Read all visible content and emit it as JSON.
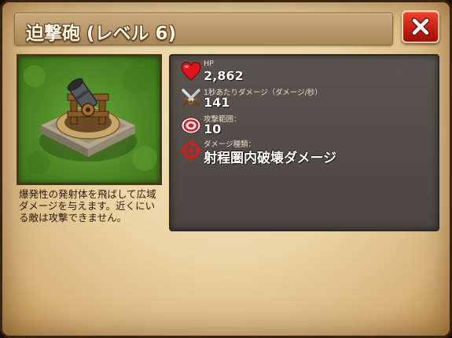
{
  "dialog": {
    "title": "迫撃砲 (レベル 6)",
    "close_icon": "close-x-icon",
    "description": "爆発性の発射体を飛ばして広域ダメージを与えます。近くにいる敵は攻撃できません。"
  },
  "stats": [
    {
      "icon": "heart-icon",
      "label": "HP",
      "value": "2,862"
    },
    {
      "icon": "crossed-swords-icon",
      "label": "1秒あたりダメージ（ダメージ/秒）",
      "value": "141"
    },
    {
      "icon": "target-icon",
      "label": "攻撃範囲：",
      "value": "10"
    },
    {
      "icon": "crosshair-icon",
      "label": "ダメージ種類：",
      "value": "射程圏内破壊ダメージ"
    }
  ],
  "colors": {
    "title_bar": "#b9976a",
    "close_button": "#d62a1a",
    "stats_panel": "#524d48",
    "parchment": "#ead3a2"
  }
}
